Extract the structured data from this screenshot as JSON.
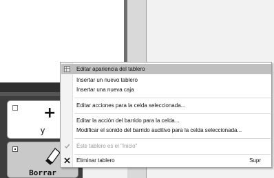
{
  "context_menu": {
    "items": [
      {
        "label": "Editar apariencia del tablero",
        "icon": "edit-appearance-icon"
      },
      {
        "label": "Insertar un nuevo tablero"
      },
      {
        "label": "Insertar una nueva caja"
      },
      {
        "label": "Editar acciones para la celda seleccionada..."
      },
      {
        "label": "Editar la acción del barrido para la celda..."
      },
      {
        "label": "Modificar el sonido del barrido auditivo para la celda seleccionada..."
      },
      {
        "label": "Éste tablero es el \"Inicio\"",
        "icon": "checkmark-icon",
        "state": "disabled"
      },
      {
        "label": "Eliminar tablero",
        "icon": "close-x-icon",
        "shortcut": "Supr"
      }
    ]
  },
  "board": {
    "cells": [
      {
        "label": "y",
        "icon": "plus-icon"
      },
      {
        "label": "Borrar",
        "icon": "eraser-icon"
      }
    ]
  }
}
